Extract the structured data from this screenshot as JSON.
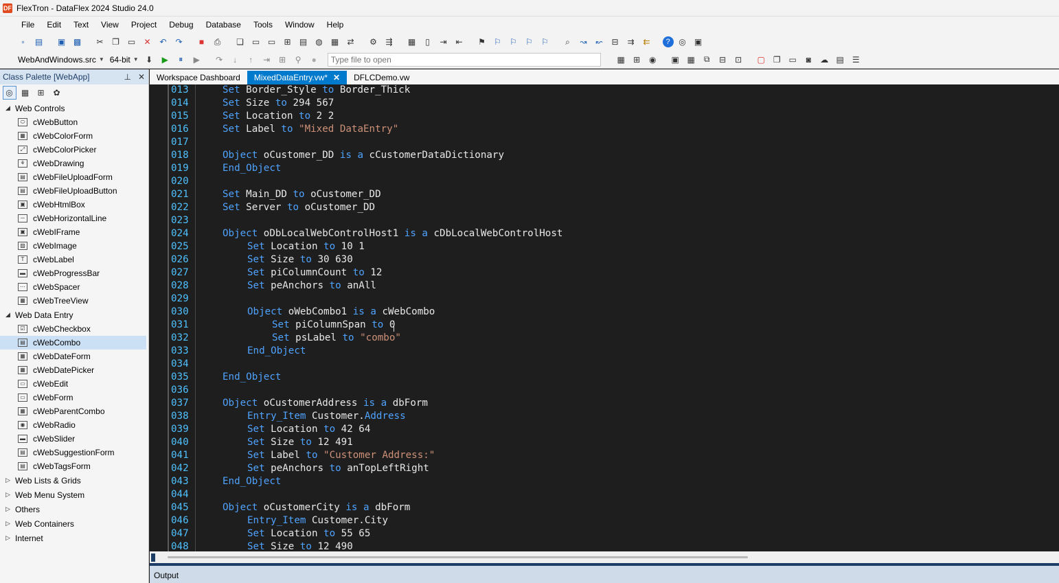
{
  "window": {
    "title": "FlexTron - DataFlex 2024 Studio 24.0"
  },
  "menu": [
    "File",
    "Edit",
    "Text",
    "View",
    "Project",
    "Debug",
    "Database",
    "Tools",
    "Window",
    "Help"
  ],
  "toolbar": {
    "workspace_combo": "WebAndWindows.src",
    "bitness_combo": "64-bit",
    "file_open_placeholder": "Type file to open"
  },
  "sidebar": {
    "title": "Class Palette [WebApp]",
    "groups": [
      {
        "label": "Web Controls",
        "expanded": true,
        "items": [
          "cWebButton",
          "cWebColorForm",
          "cWebColorPicker",
          "cWebDrawing",
          "cWebFileUploadForm",
          "cWebFileUploadButton",
          "cWebHtmlBox",
          "cWebHorizontalLine",
          "cWebIFrame",
          "cWebImage",
          "cWebLabel",
          "cWebProgressBar",
          "cWebSpacer",
          "cWebTreeView"
        ]
      },
      {
        "label": "Web Data Entry",
        "expanded": true,
        "items": [
          "cWebCheckbox",
          "cWebCombo",
          "cWebDateForm",
          "cWebDatePicker",
          "cWebEdit",
          "cWebForm",
          "cWebParentCombo",
          "cWebRadio",
          "cWebSlider",
          "cWebSuggestionForm",
          "cWebTagsForm"
        ]
      },
      {
        "label": "Web Lists & Grids",
        "expanded": false,
        "items": []
      },
      {
        "label": "Web Menu System",
        "expanded": false,
        "items": []
      },
      {
        "label": "Others",
        "expanded": false,
        "items": []
      },
      {
        "label": "Web Containers",
        "expanded": false,
        "items": []
      },
      {
        "label": "Internet",
        "expanded": false,
        "items": []
      }
    ],
    "selected_item": "cWebCombo"
  },
  "tabs": [
    {
      "label": "Workspace Dashboard",
      "active": false
    },
    {
      "label": "MixedDataEntry.vw*",
      "active": true
    },
    {
      "label": "DFLCDemo.vw",
      "active": false
    }
  ],
  "editor": {
    "lines": [
      {
        "n": "013",
        "indent": 0,
        "tokens": [
          [
            "kw",
            "Set"
          ],
          [
            "tx",
            " Border_Style "
          ],
          [
            "kw",
            "to"
          ],
          [
            "tx",
            " Border_Thick"
          ]
        ]
      },
      {
        "n": "014",
        "indent": 0,
        "tokens": [
          [
            "kw",
            "Set"
          ],
          [
            "tx",
            " Size "
          ],
          [
            "kw",
            "to"
          ],
          [
            "tx",
            " 294 567"
          ]
        ]
      },
      {
        "n": "015",
        "indent": 0,
        "tokens": [
          [
            "kw",
            "Set"
          ],
          [
            "tx",
            " Location "
          ],
          [
            "kw",
            "to"
          ],
          [
            "tx",
            " 2 2"
          ]
        ]
      },
      {
        "n": "016",
        "indent": 0,
        "tokens": [
          [
            "kw",
            "Set"
          ],
          [
            "tx",
            " Label "
          ],
          [
            "kw",
            "to"
          ],
          [
            "st",
            " \"Mixed DataEntry\""
          ]
        ]
      },
      {
        "n": "017",
        "indent": 0,
        "tokens": []
      },
      {
        "n": "018",
        "indent": 0,
        "tokens": [
          [
            "kw",
            "Object"
          ],
          [
            "tx",
            " oCustomer_DD "
          ],
          [
            "kw",
            "is a"
          ],
          [
            "tx",
            " cCustomerDataDictionary"
          ]
        ]
      },
      {
        "n": "019",
        "indent": 0,
        "tokens": [
          [
            "kw",
            "End_Object"
          ]
        ]
      },
      {
        "n": "020",
        "indent": 0,
        "tokens": []
      },
      {
        "n": "021",
        "indent": 0,
        "tokens": [
          [
            "kw",
            "Set"
          ],
          [
            "tx",
            " Main_DD "
          ],
          [
            "kw",
            "to"
          ],
          [
            "tx",
            " oCustomer_DD"
          ]
        ]
      },
      {
        "n": "022",
        "indent": 0,
        "tokens": [
          [
            "kw",
            "Set"
          ],
          [
            "tx",
            " Server "
          ],
          [
            "kw",
            "to"
          ],
          [
            "tx",
            " oCustomer_DD"
          ]
        ]
      },
      {
        "n": "023",
        "indent": 0,
        "tokens": []
      },
      {
        "n": "024",
        "indent": 0,
        "tokens": [
          [
            "kw",
            "Object"
          ],
          [
            "tx",
            " oDbLocalWebControlHost1 "
          ],
          [
            "kw",
            "is a"
          ],
          [
            "tx",
            " cDbLocalWebControlHost"
          ]
        ]
      },
      {
        "n": "025",
        "indent": 1,
        "tokens": [
          [
            "kw",
            "Set"
          ],
          [
            "tx",
            " Location "
          ],
          [
            "kw",
            "to"
          ],
          [
            "tx",
            " 10 1"
          ]
        ]
      },
      {
        "n": "026",
        "indent": 1,
        "tokens": [
          [
            "kw",
            "Set"
          ],
          [
            "tx",
            " Size "
          ],
          [
            "kw",
            "to"
          ],
          [
            "tx",
            " 30 630"
          ]
        ]
      },
      {
        "n": "027",
        "indent": 1,
        "tokens": [
          [
            "kw",
            "Set"
          ],
          [
            "tx",
            " piColumnCount "
          ],
          [
            "kw",
            "to"
          ],
          [
            "tx",
            " 12"
          ]
        ]
      },
      {
        "n": "028",
        "indent": 1,
        "tokens": [
          [
            "kw",
            "Set"
          ],
          [
            "tx",
            " peAnchors "
          ],
          [
            "kw",
            "to"
          ],
          [
            "tx",
            " anAll"
          ]
        ]
      },
      {
        "n": "029",
        "indent": 0,
        "tokens": []
      },
      {
        "n": "030",
        "indent": 1,
        "tokens": [
          [
            "kw",
            "Object"
          ],
          [
            "tx",
            " oWebCombo1 "
          ],
          [
            "kw",
            "is a"
          ],
          [
            "tx",
            " cWebCombo"
          ]
        ]
      },
      {
        "n": "031",
        "indent": 2,
        "tokens": [
          [
            "kw",
            "Set"
          ],
          [
            "tx",
            " piColumnSpan "
          ],
          [
            "kw",
            "to"
          ],
          [
            "tx",
            " 0"
          ]
        ]
      },
      {
        "n": "032",
        "indent": 2,
        "tokens": [
          [
            "kw",
            "Set"
          ],
          [
            "tx",
            " psLabel "
          ],
          [
            "kw",
            "to"
          ],
          [
            "st",
            " \"combo\""
          ]
        ]
      },
      {
        "n": "033",
        "indent": 1,
        "tokens": [
          [
            "kw",
            "End_Object"
          ]
        ]
      },
      {
        "n": "034",
        "indent": 0,
        "tokens": []
      },
      {
        "n": "035",
        "indent": 0,
        "tokens": [
          [
            "kw",
            "End_Object"
          ]
        ]
      },
      {
        "n": "036",
        "indent": 0,
        "tokens": []
      },
      {
        "n": "037",
        "indent": 0,
        "tokens": [
          [
            "kw",
            "Object"
          ],
          [
            "tx",
            " oCustomerAddress "
          ],
          [
            "kw",
            "is a"
          ],
          [
            "tx",
            " dbForm"
          ]
        ]
      },
      {
        "n": "038",
        "indent": 1,
        "tokens": [
          [
            "kw",
            "Entry_Item"
          ],
          [
            "tx",
            " Customer."
          ],
          [
            "kw",
            "Address"
          ]
        ]
      },
      {
        "n": "039",
        "indent": 1,
        "tokens": [
          [
            "kw",
            "Set"
          ],
          [
            "tx",
            " Location "
          ],
          [
            "kw",
            "to"
          ],
          [
            "tx",
            " 42 64"
          ]
        ]
      },
      {
        "n": "040",
        "indent": 1,
        "tokens": [
          [
            "kw",
            "Set"
          ],
          [
            "tx",
            " Size "
          ],
          [
            "kw",
            "to"
          ],
          [
            "tx",
            " 12 491"
          ]
        ]
      },
      {
        "n": "041",
        "indent": 1,
        "tokens": [
          [
            "kw",
            "Set"
          ],
          [
            "tx",
            " Label "
          ],
          [
            "kw",
            "to"
          ],
          [
            "st",
            " \"Customer Address:\""
          ]
        ]
      },
      {
        "n": "042",
        "indent": 1,
        "tokens": [
          [
            "kw",
            "Set"
          ],
          [
            "tx",
            " peAnchors "
          ],
          [
            "kw",
            "to"
          ],
          [
            "tx",
            " anTopLeftRight"
          ]
        ]
      },
      {
        "n": "043",
        "indent": 0,
        "tokens": [
          [
            "kw",
            "End_Object"
          ]
        ]
      },
      {
        "n": "044",
        "indent": 0,
        "tokens": []
      },
      {
        "n": "045",
        "indent": 0,
        "tokens": [
          [
            "kw",
            "Object"
          ],
          [
            "tx",
            " oCustomerCity "
          ],
          [
            "kw",
            "is a"
          ],
          [
            "tx",
            " dbForm"
          ]
        ]
      },
      {
        "n": "046",
        "indent": 1,
        "tokens": [
          [
            "kw",
            "Entry_Item"
          ],
          [
            "tx",
            " Customer.City"
          ]
        ]
      },
      {
        "n": "047",
        "indent": 1,
        "tokens": [
          [
            "kw",
            "Set"
          ],
          [
            "tx",
            " Location "
          ],
          [
            "kw",
            "to"
          ],
          [
            "tx",
            " 55 65"
          ]
        ]
      },
      {
        "n": "048",
        "indent": 1,
        "tokens": [
          [
            "kw",
            "Set"
          ],
          [
            "tx",
            " Size "
          ],
          [
            "kw",
            "to"
          ],
          [
            "tx",
            " 12 490"
          ]
        ]
      }
    ]
  },
  "output_panel": {
    "title": "Output"
  },
  "colors": {
    "accent": "#007acc",
    "keyword": "#4fa3ff",
    "string": "#ce9178",
    "editor_bg": "#1e1e1e"
  }
}
